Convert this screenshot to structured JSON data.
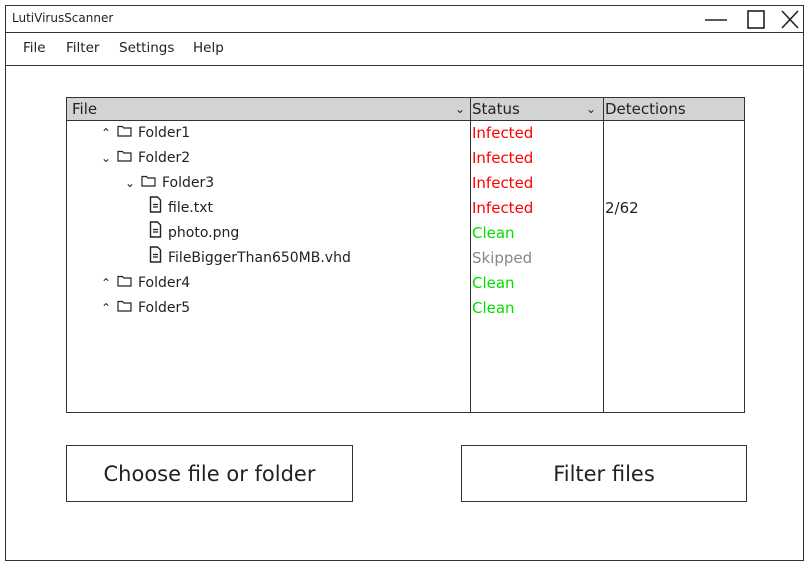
{
  "window": {
    "title": "LutiVirusScanner"
  },
  "menu": [
    "File",
    "Filter",
    "Settings",
    "Help"
  ],
  "table": {
    "columns": {
      "file": "File",
      "status": "Status",
      "detections": "Detections"
    },
    "rows": [
      {
        "kind": "folder",
        "expanded": false,
        "depth": 0,
        "name": "Folder1",
        "status": "Infected",
        "status_color": "#ff0000",
        "detections": ""
      },
      {
        "kind": "folder",
        "expanded": true,
        "depth": 0,
        "name": "Folder2",
        "status": "Infected",
        "status_color": "#ff0000",
        "detections": ""
      },
      {
        "kind": "folder",
        "expanded": true,
        "depth": 1,
        "name": "Folder3",
        "status": "Infected",
        "status_color": "#ff0000",
        "detections": ""
      },
      {
        "kind": "file",
        "depth": 2,
        "name": "file.txt",
        "status": "Infected",
        "status_color": "#ff0000",
        "detections": "2/62"
      },
      {
        "kind": "file",
        "depth": 2,
        "name": "photo.png",
        "status": "Clean",
        "status_color": "#00dd00",
        "detections": ""
      },
      {
        "kind": "file",
        "depth": 2,
        "name": "FileBiggerThan650MB.vhd",
        "status": "Skipped",
        "status_color": "#888888",
        "detections": ""
      },
      {
        "kind": "folder",
        "expanded": false,
        "depth": 0,
        "name": "Folder4",
        "status": "Clean",
        "status_color": "#00dd00",
        "detections": ""
      },
      {
        "kind": "folder",
        "expanded": false,
        "depth": 0,
        "name": "Folder5",
        "status": "Clean",
        "status_color": "#00dd00",
        "detections": ""
      }
    ]
  },
  "buttons": {
    "choose": "Choose file or folder",
    "filter": "Filter files"
  }
}
